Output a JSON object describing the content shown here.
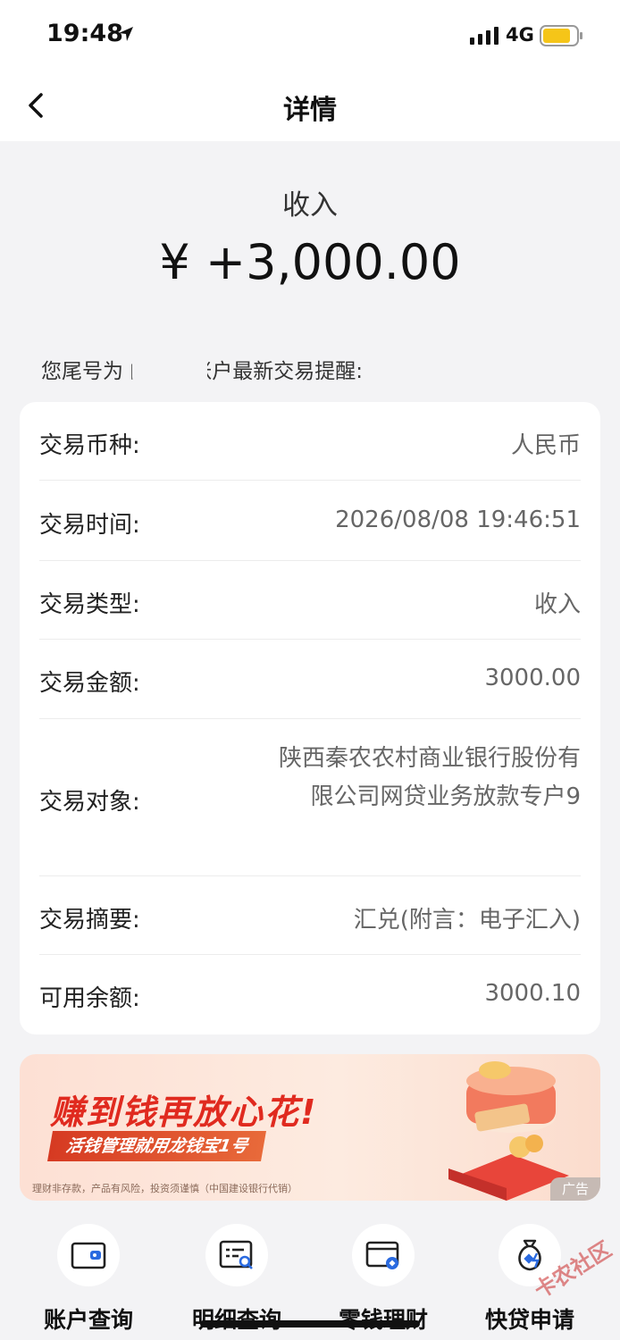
{
  "status_bar": {
    "time": "19:48",
    "network": "4G",
    "icons": [
      "location-arrow-icon",
      "signal-icon",
      "battery-icon"
    ],
    "battery_color": "#f5c518"
  },
  "nav": {
    "title": "详情",
    "back_icon": "chevron-left-icon"
  },
  "summary": {
    "type": "收入",
    "amount": "¥ +3,000.00"
  },
  "notice": "您尾号为        的储蓄账户最新交易提醒:",
  "details": [
    {
      "label": "交易币种:",
      "value": "人民币"
    },
    {
      "label": "交易时间:",
      "value": "2026/08/08 19:46:51"
    },
    {
      "label": "交易类型:",
      "value": "收入"
    },
    {
      "label": "交易金额:",
      "value": "3000.00"
    },
    {
      "label": "交易对象:",
      "value": "陕西秦农农村商业银行股份有限公司网贷业务放款专户9"
    },
    {
      "label": "交易摘要:",
      "value": "汇兑(附言：电子汇入)"
    },
    {
      "label": "可用余额:",
      "value": "3000.10"
    }
  ],
  "banner": {
    "title": "赚到钱再放心花!",
    "subtitle": "活钱管理就用龙钱宝1号",
    "fine_print": "理财非存款，产品有风险，投资须谨慎（中国建设银行代销）",
    "ad_label": "广告",
    "accent_color": "#e02a1f"
  },
  "quick_actions": [
    {
      "label": "账户查询",
      "icon": "wallet-icon"
    },
    {
      "label": "明细查询",
      "icon": "statement-search-icon"
    },
    {
      "label": "零钱理财",
      "icon": "card-coin-icon"
    },
    {
      "label": "快贷申请",
      "icon": "money-bag-icon"
    }
  ],
  "watermark": "卡农社区"
}
